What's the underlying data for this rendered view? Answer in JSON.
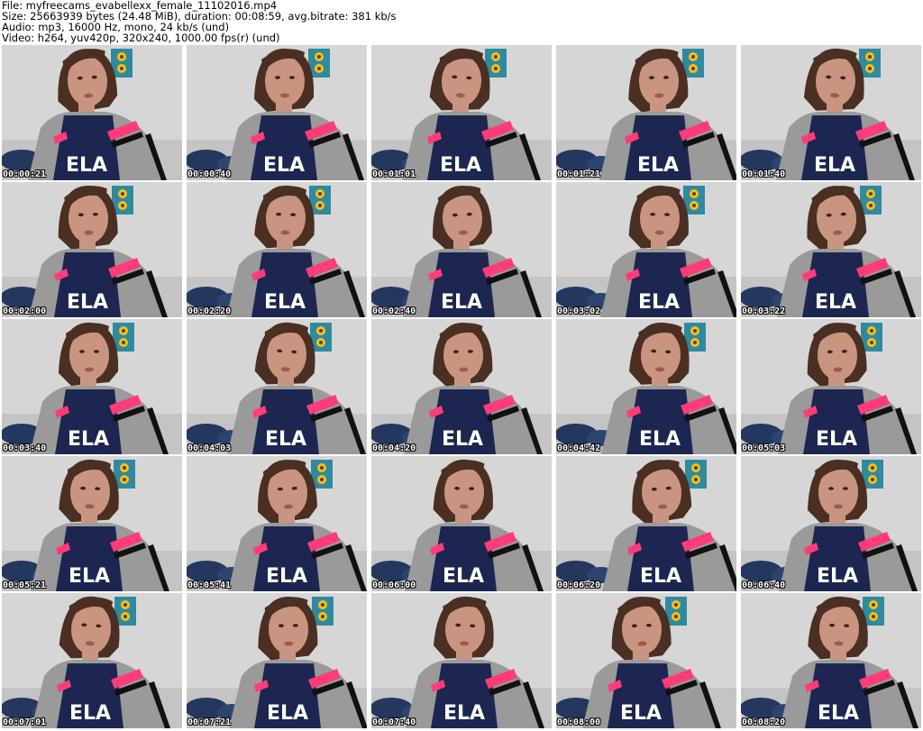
{
  "header": {
    "file_line": "File: myfreecams_evabellexx_female_11102016.mp4",
    "size_line": "Size: 25663939 bytes (24.48 MiB), duration: 00:08:59, avg.bitrate: 381 kb/s",
    "audio_line": "Audio: mp3, 16000 Hz, mono, 24 kb/s (und)",
    "video_line": "Video: h264, yuv420p, 320x240, 1000.00 fps(r) (und)"
  },
  "thumbnails": [
    {
      "timestamp": "00:00:21"
    },
    {
      "timestamp": "00:00:40"
    },
    {
      "timestamp": "00:01:01"
    },
    {
      "timestamp": "00:01:21"
    },
    {
      "timestamp": "00:01:40"
    },
    {
      "timestamp": "00:02:00"
    },
    {
      "timestamp": "00:02:20"
    },
    {
      "timestamp": "00:02:40"
    },
    {
      "timestamp": "00:03:02"
    },
    {
      "timestamp": "00:03:22"
    },
    {
      "timestamp": "00:03:40"
    },
    {
      "timestamp": "00:04:03"
    },
    {
      "timestamp": "00:04:20"
    },
    {
      "timestamp": "00:04:42"
    },
    {
      "timestamp": "00:05:03"
    },
    {
      "timestamp": "00:05:21"
    },
    {
      "timestamp": "00:05:41"
    },
    {
      "timestamp": "00:06:00"
    },
    {
      "timestamp": "00:06:20"
    },
    {
      "timestamp": "00:06:40"
    },
    {
      "timestamp": "00:07:01"
    },
    {
      "timestamp": "00:07:21"
    },
    {
      "timestamp": "00:07:40"
    },
    {
      "timestamp": "00:08:00"
    },
    {
      "timestamp": "00:08:20"
    }
  ],
  "colors": {
    "wall": "#d6d6d6",
    "hair": "#4a2f22",
    "skin": "#c99580",
    "jacket": "#9a9a9a",
    "stripe_pink": "#ff3c78",
    "shirt_navy": "#1c2650",
    "poster_teal": "#2f8aa0",
    "poster_yellow": "#f2c21b",
    "pillow_navy": "#24375e"
  }
}
